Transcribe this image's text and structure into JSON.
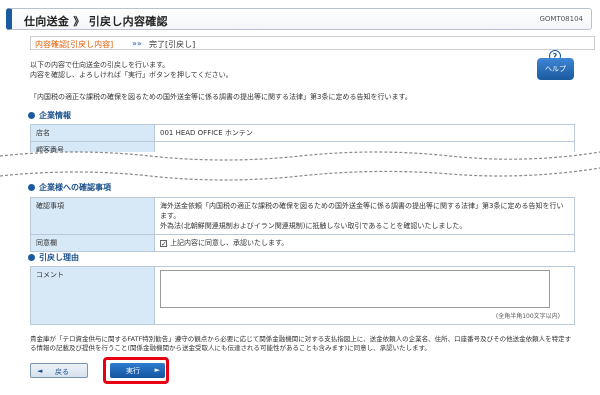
{
  "header": {
    "title": "仕向送金 》 引戻し内容確認",
    "screen_id": "GOMT08104"
  },
  "steps": {
    "current": "内容確認[引戻し内容]",
    "separator": "»»",
    "next": "完了[引戻し]"
  },
  "intro": {
    "line1": "以下の内容で仕向送金の引戻しを行います。",
    "line2": "内容を確認し、よろしければ「実行」ボタンを押してください。",
    "line3": "「内国税の適正な課税の確保を図るための国外送金等に係る調書の提出等に関する法律」第3条に定める告知を行います。"
  },
  "help": {
    "icon": "?",
    "label": "ヘルプ"
  },
  "company_info": {
    "heading": "企業情報",
    "rows": [
      {
        "label": "店名",
        "value": "001 HEAD OFFICE ホンテン"
      },
      {
        "label": "顧客番号",
        "value": ""
      }
    ]
  },
  "confirm_section": {
    "heading": "企業様への確認事項",
    "confirm_label": "確認事項",
    "confirm_line1": "海外送金依頼「内国税の適正な課税の確保を図るための国外送金等に係る調書の提出等に関する法律」第3条に定める告知を行います。",
    "confirm_line2": "外為法(北朝鮮関連規制およびイラン関連規制)に抵触しない取引であることを確認いたしました。",
    "agree_label": "同意欄",
    "agree_text": "上記内容に同意し、承認いたします。"
  },
  "reason_section": {
    "heading": "引戻し理由",
    "comment_label": "コメント",
    "comment_value": "",
    "char_limit": "(全角半角100文字以内)"
  },
  "disclaimer": "貴金庫が「テロ資金供与に関するFATF特別勧告」遵守の観点から必要に応じて関係金融機関に対する支払指図上に、送金依頼人の企業名、住所、口座番号及びその他送金依頼人を特定する情報の記載及び提供を行うこと(関係金融機関から送金受取人にも伝達される可能性があることも含みます)に同意し、承認いたします。",
  "buttons": {
    "back_label": "戻る",
    "back_arrow": "◄",
    "exec_label": "実行",
    "exec_arrow": "►"
  },
  "colors": {
    "accent": "#1a5a9e",
    "highlight": "#e60012",
    "step_current": "#e05a00"
  }
}
